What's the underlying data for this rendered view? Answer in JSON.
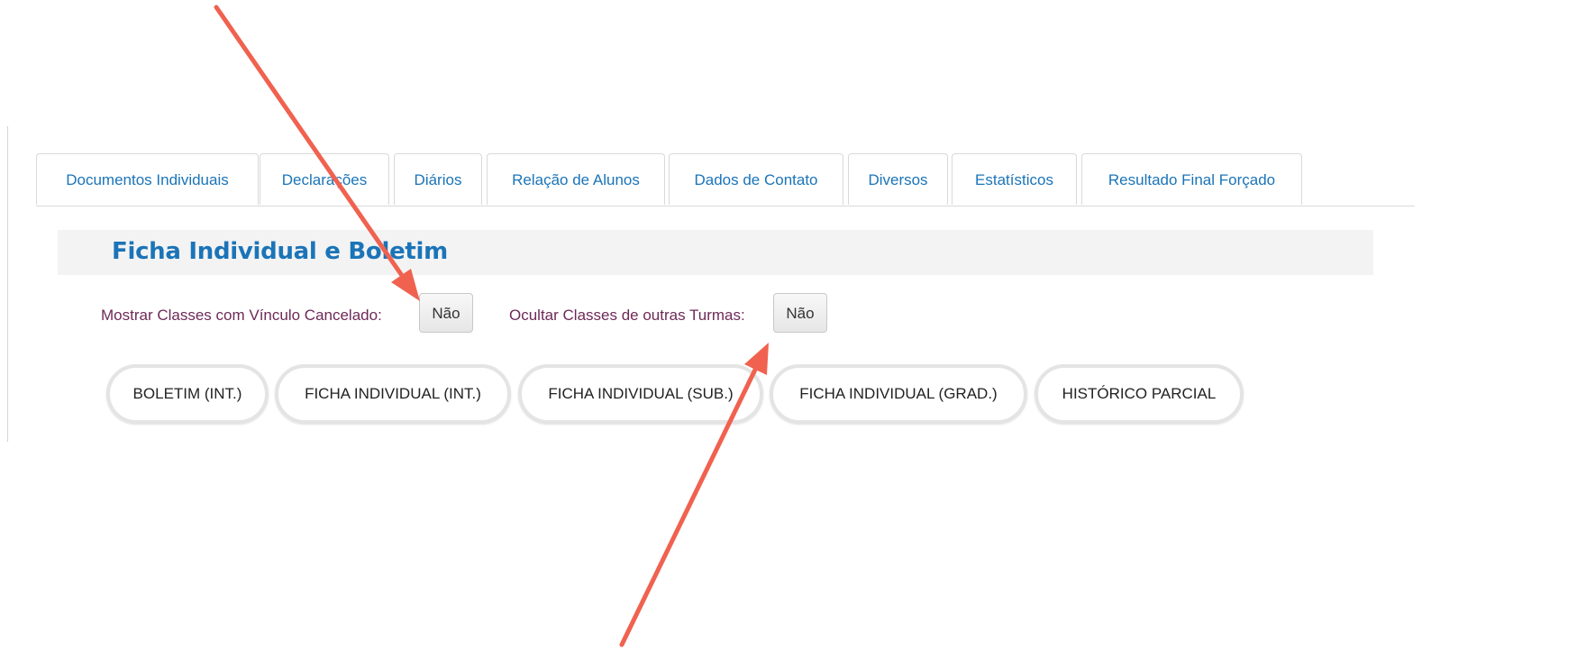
{
  "tabs": [
    {
      "label": "Documentos Individuais"
    },
    {
      "label": "Declarações"
    },
    {
      "label": "Diários"
    },
    {
      "label": "Relação de Alunos"
    },
    {
      "label": "Dados de Contato"
    },
    {
      "label": "Diversos"
    },
    {
      "label": "Estatísticos"
    },
    {
      "label": "Resultado Final Forçado"
    }
  ],
  "section": {
    "title": "Ficha Individual e Boletim"
  },
  "options": {
    "show_cancelled_label": "Mostrar Classes com Vínculo Cancelado:",
    "show_cancelled_value": "Não",
    "hide_other_label": "Ocultar Classes de outras Turmas:",
    "hide_other_value": "Não"
  },
  "actions": [
    {
      "label": "BOLETIM (INT.)"
    },
    {
      "label": "FICHA INDIVIDUAL (INT.)"
    },
    {
      "label": "FICHA INDIVIDUAL (SUB.)"
    },
    {
      "label": "FICHA INDIVIDUAL (GRAD.)"
    },
    {
      "label": "HISTÓRICO PARCIAL"
    }
  ],
  "colors": {
    "link_blue": "#1b74b8",
    "label_purple": "#6d2a57",
    "annotation_arrow": "#f0624f"
  }
}
